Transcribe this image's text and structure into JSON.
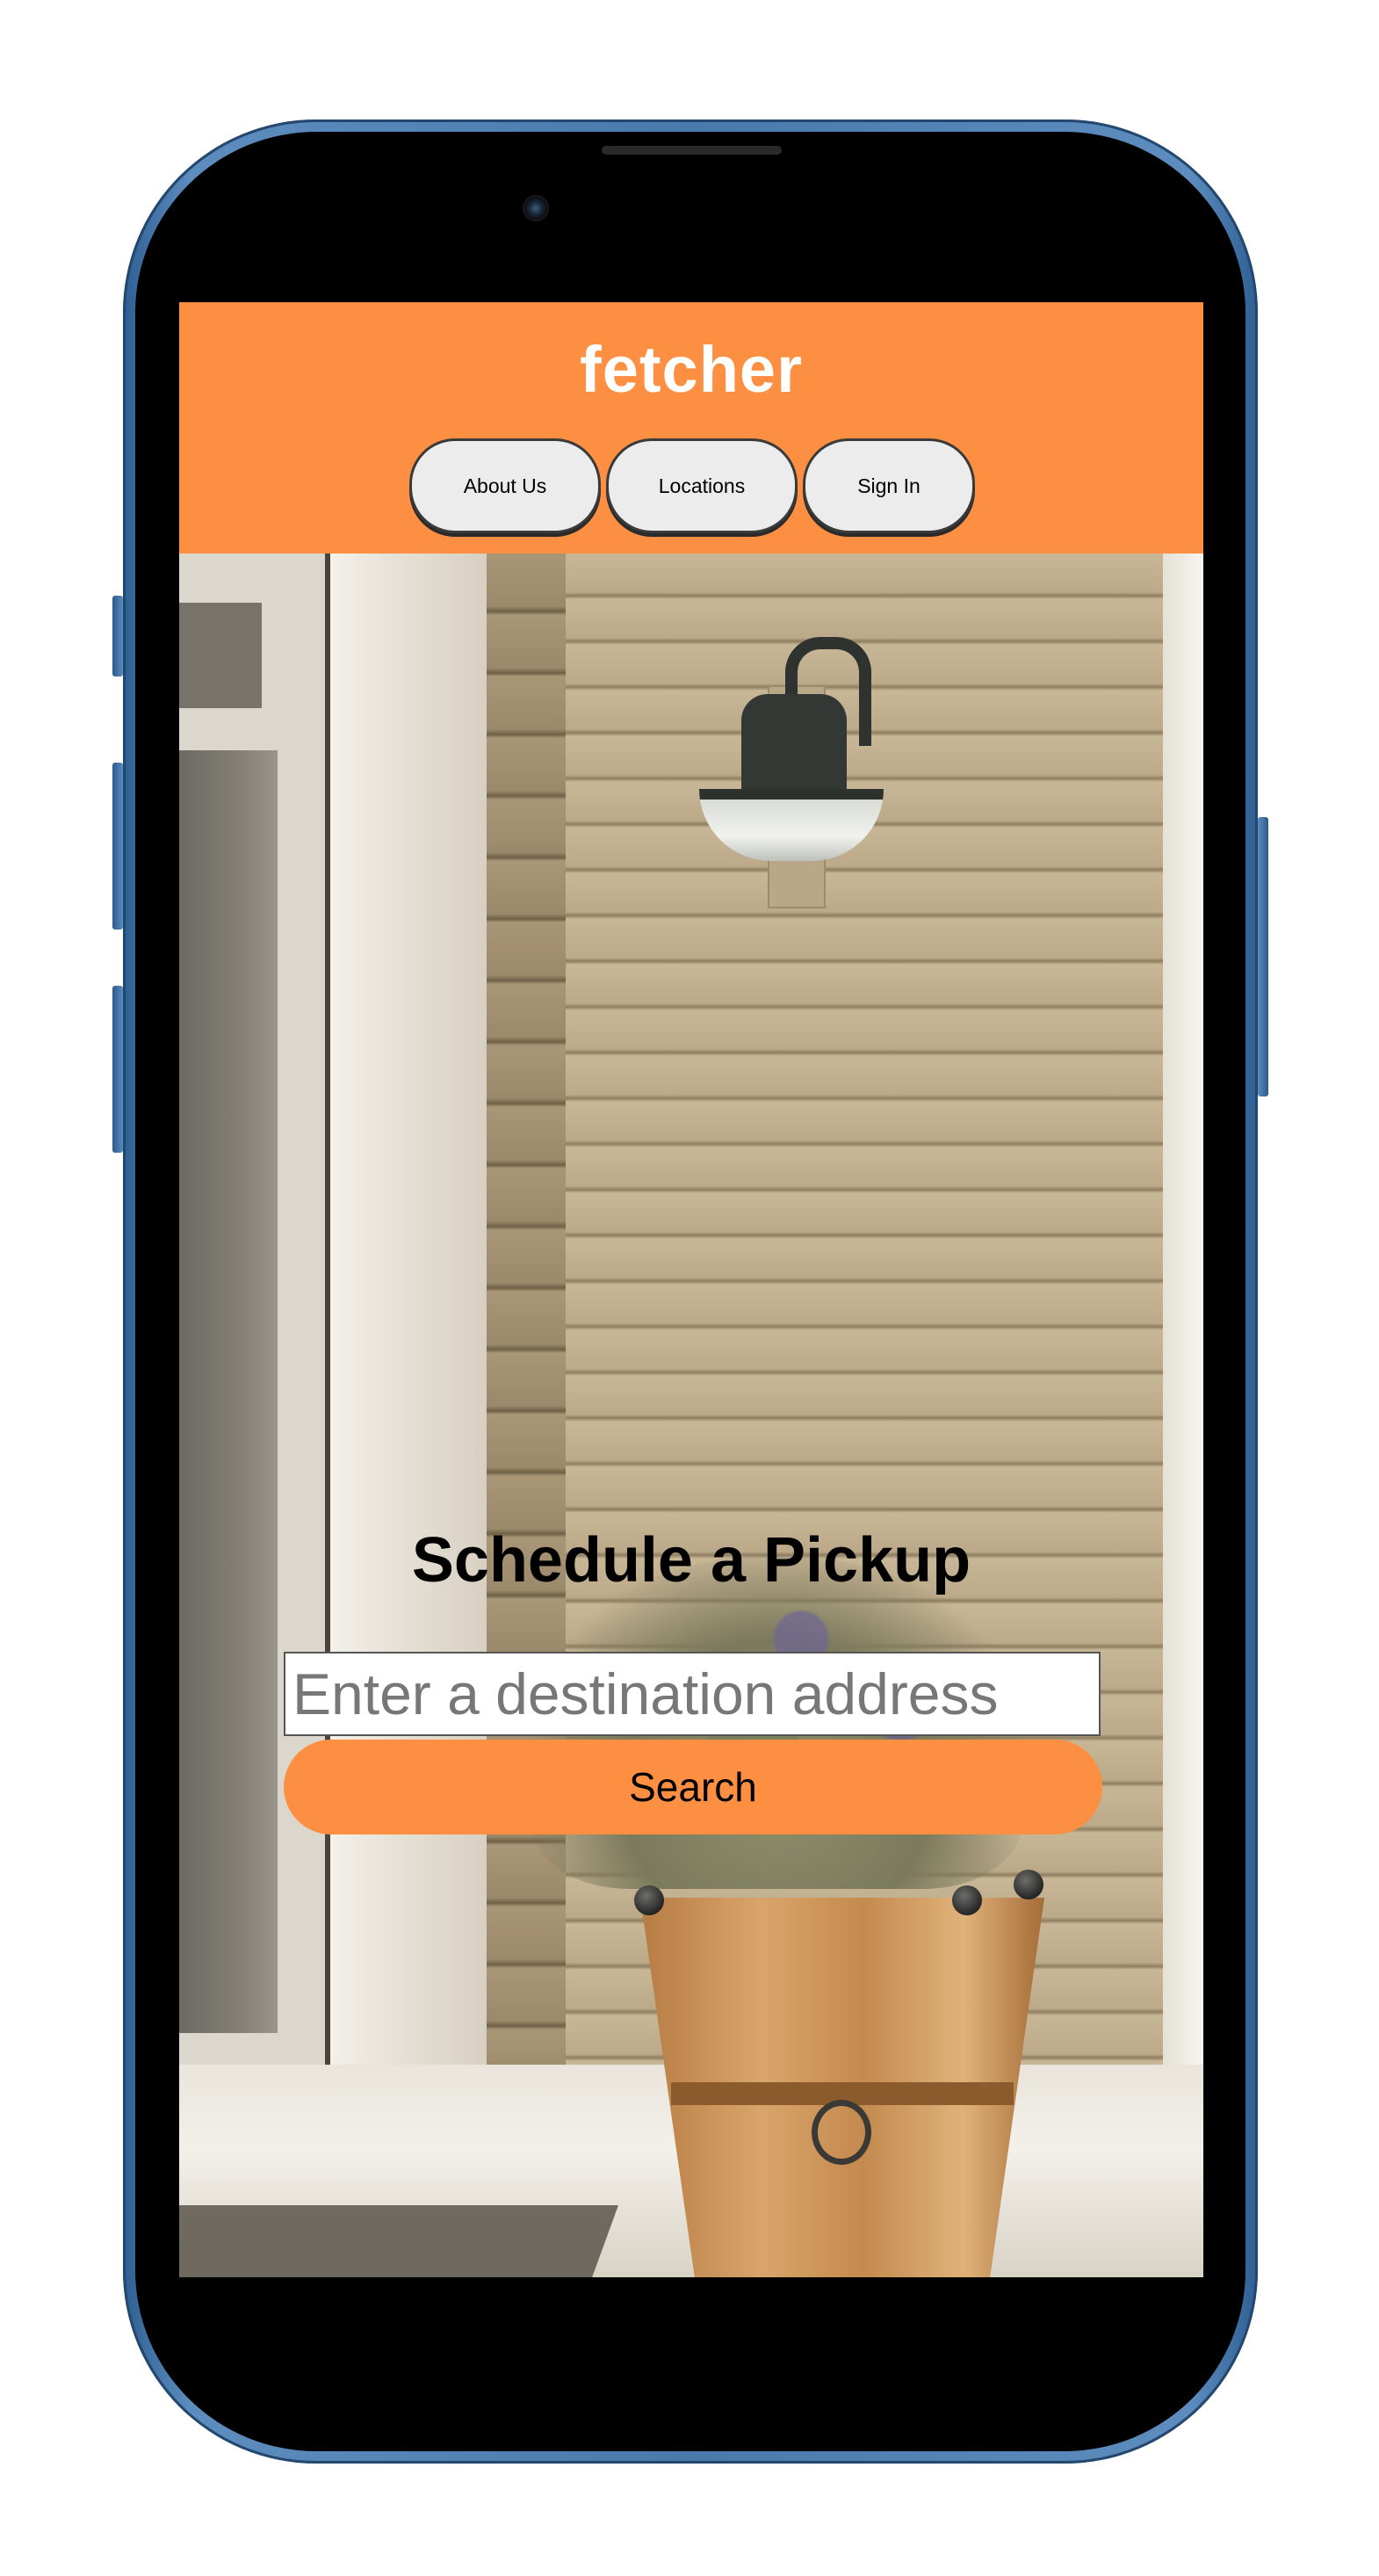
{
  "device": {
    "frame_color": "#4a79ab",
    "icons": [
      "camera-icon",
      "speaker-icon"
    ]
  },
  "site": {
    "brand": "fetcher",
    "header_color": "#fd8f42"
  },
  "nav": {
    "about": "About Us",
    "locations": "Locations",
    "sign_in": "Sign In"
  },
  "hero": {
    "title": "Schedule a Pickup",
    "input_placeholder": "Enter a destination address",
    "input_value": "",
    "search_label": "Search",
    "accent_color": "#fd8f42"
  }
}
